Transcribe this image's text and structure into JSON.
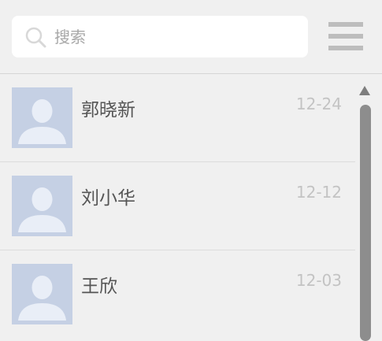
{
  "search": {
    "placeholder": "搜索",
    "value": ""
  },
  "icons": {
    "search": "search-icon",
    "menu": "hamburger-menu-icon",
    "avatar": "default-avatar-icon",
    "scroll_up": "triangle-up-icon"
  },
  "contacts": [
    {
      "name": "郭晓新",
      "date": "12-24"
    },
    {
      "name": "刘小华",
      "date": "12-12"
    },
    {
      "name": "王欣",
      "date": "12-03"
    }
  ],
  "colors": {
    "avatar_bg": "#c5d0e4",
    "avatar_fg": "#e9eef7",
    "date": "#c3c3c3",
    "name": "#555555",
    "scrollbar": "#8d8d8d"
  }
}
